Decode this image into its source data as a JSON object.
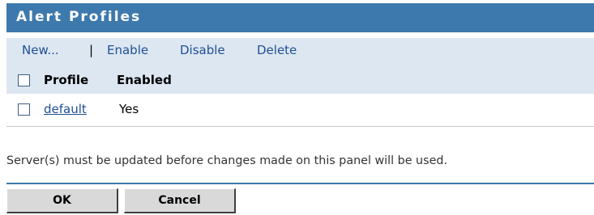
{
  "panel": {
    "title": "Alert Profiles"
  },
  "toolbar": {
    "new_label": "New...",
    "separator": "|",
    "enable_label": "Enable",
    "disable_label": "Disable",
    "delete_label": "Delete"
  },
  "table": {
    "columns": [
      "Profile",
      "Enabled"
    ],
    "rows": [
      {
        "profile": "default",
        "enabled": "Yes"
      }
    ]
  },
  "notice": "Server(s) must be updated before changes made on this panel will be used.",
  "buttons": {
    "ok_label": "OK",
    "cancel_label": "Cancel"
  },
  "colors": {
    "header_bg": "#3e79ad",
    "toolbar_bg": "#dde7f1",
    "link": "#1e4f96"
  }
}
